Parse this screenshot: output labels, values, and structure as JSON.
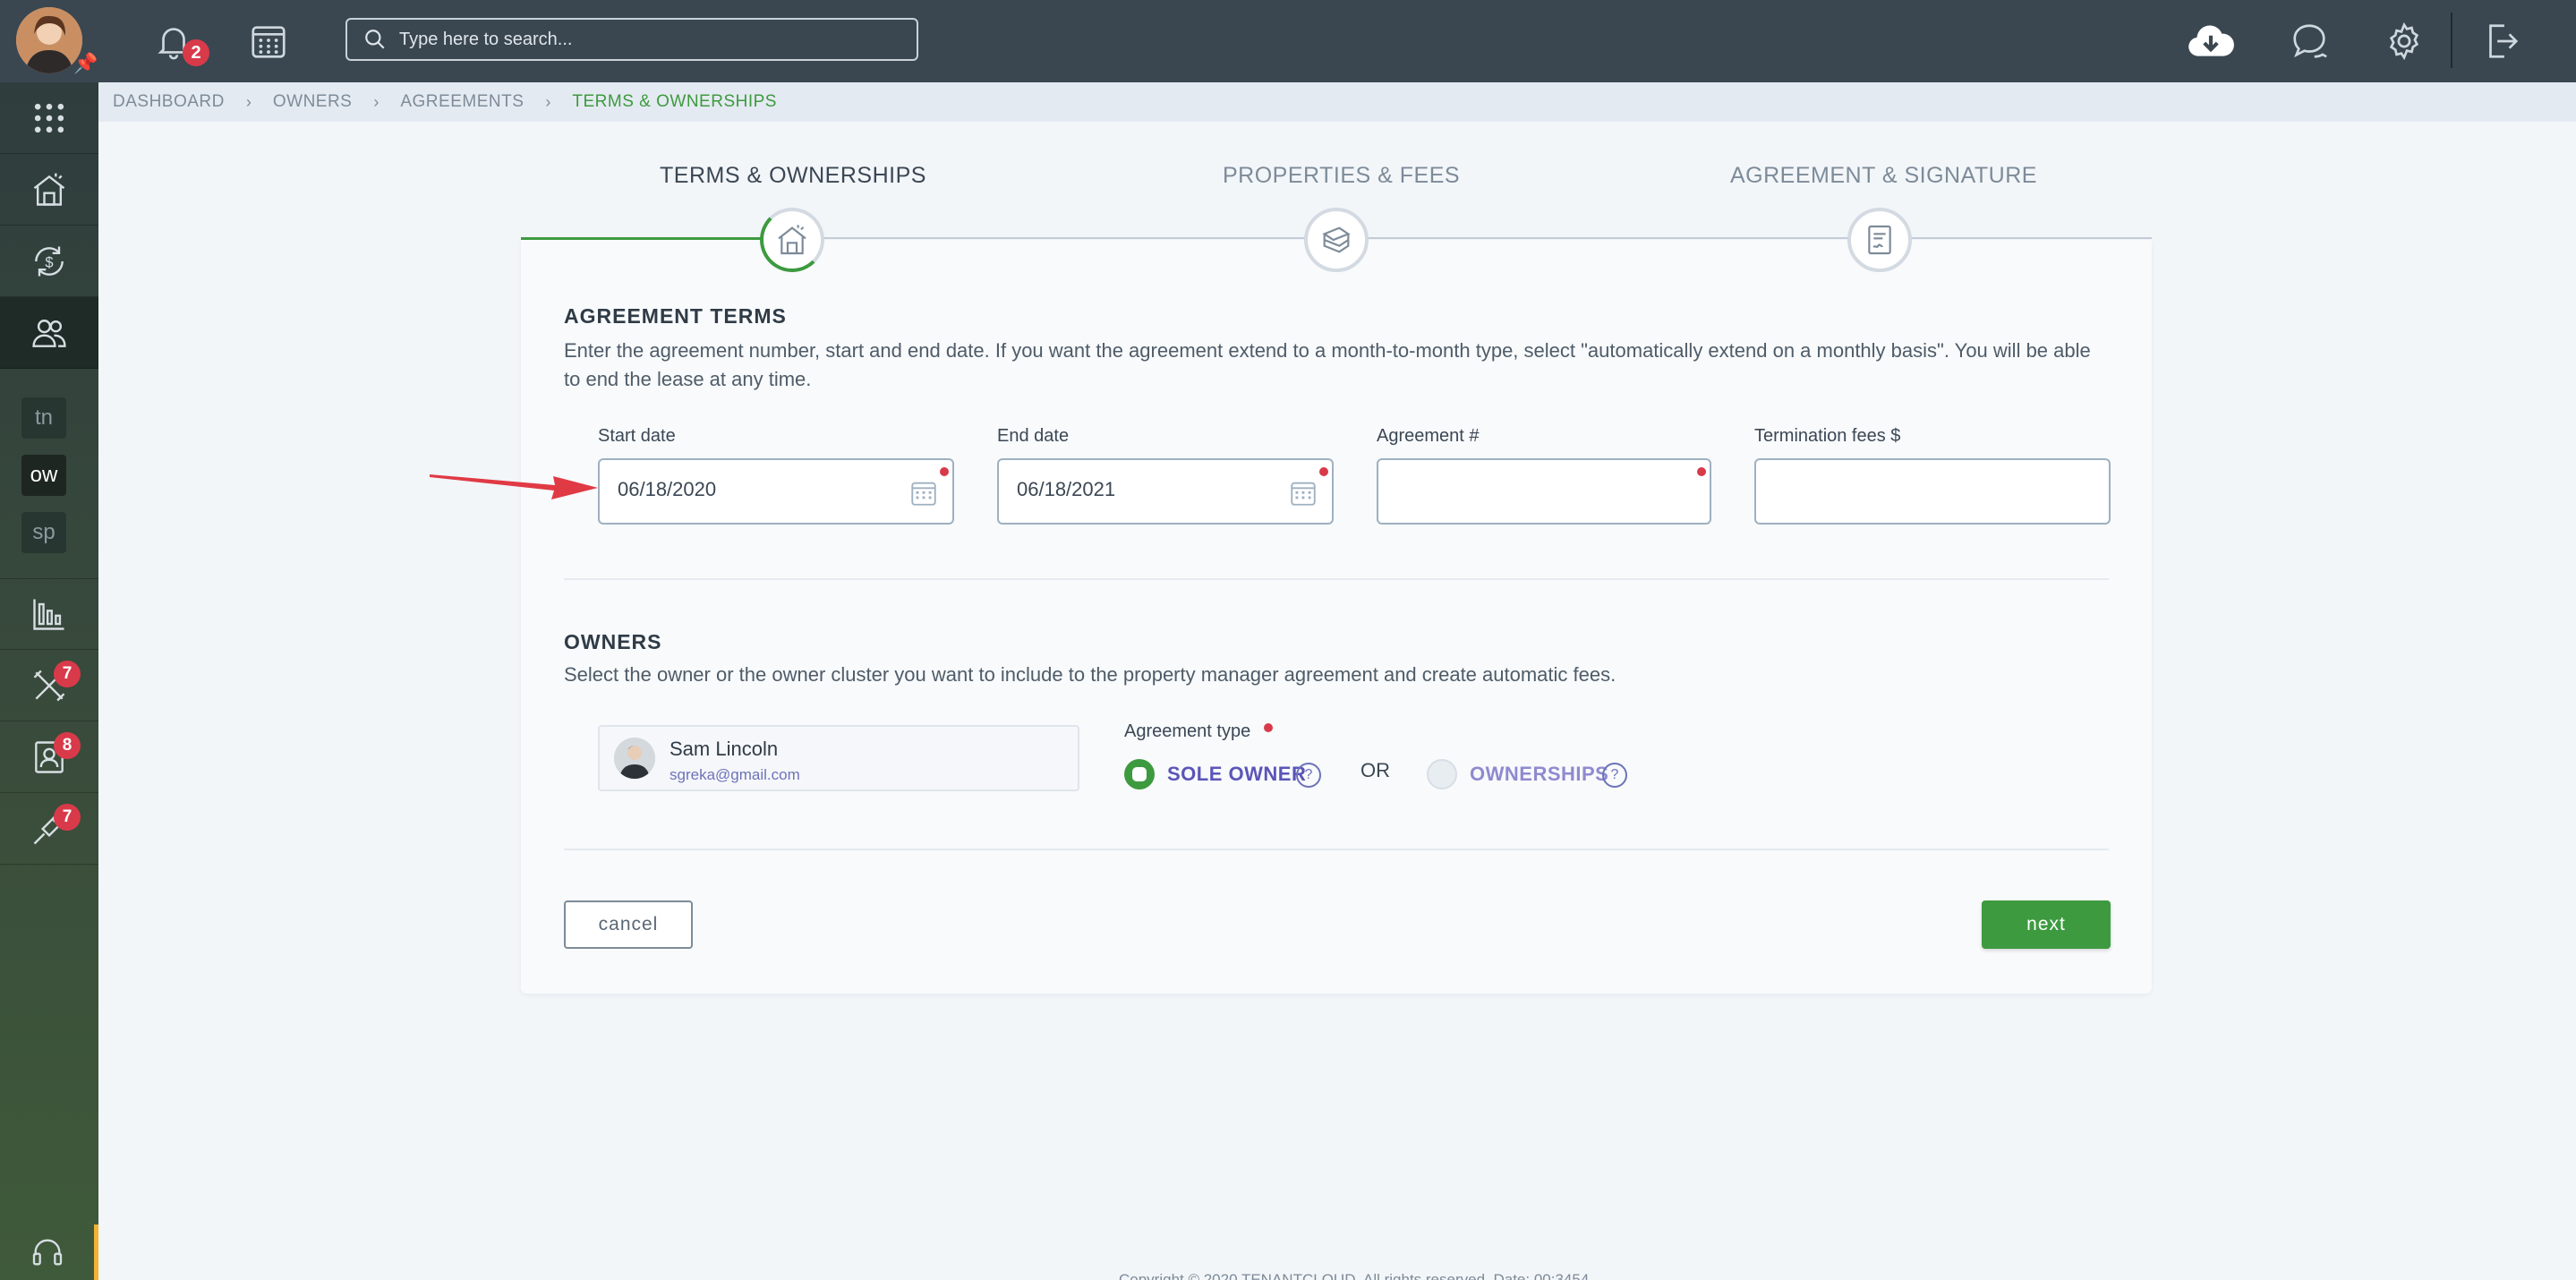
{
  "topbar": {
    "notifications_badge": "2",
    "search_placeholder": "Type here to search..."
  },
  "sidebar": {
    "chips": [
      "tn",
      "ow",
      "sp"
    ],
    "badges": {
      "maintenance": "7",
      "applications": "8",
      "tools": "7"
    }
  },
  "breadcrumb": [
    "DASHBOARD",
    "OWNERS",
    "AGREEMENTS",
    "TERMS & OWNERSHIPS"
  ],
  "steps": [
    {
      "label": "TERMS & OWNERSHIPS",
      "icon": "house-icon",
      "state": "active"
    },
    {
      "label": "PROPERTIES & FEES",
      "icon": "money-stack-icon",
      "state": "pending"
    },
    {
      "label": "AGREEMENT & SIGNATURE",
      "icon": "document-signature-icon",
      "state": "pending"
    }
  ],
  "agreement_terms": {
    "title": "AGREEMENT TERMS",
    "description_line1": "Enter the agreement number, start and end date. If you want the agreement extend to a month-to-month type, select \"automatically extend on a monthly basis\". You will be able",
    "description_line2": "to end the lease at any time.",
    "start_date": {
      "label": "Start date",
      "value": "06/18/2020"
    },
    "end_date": {
      "label": "End date",
      "value": "06/18/2021"
    },
    "agreement_number": {
      "label": "Agreement #",
      "value": ""
    },
    "termination_fees": {
      "label": "Termination fees $",
      "value": ""
    }
  },
  "owners": {
    "title": "OWNERS",
    "description": "Select the owner or the owner cluster you want to include to the property manager agreement and create automatic fees.",
    "owner": {
      "name": "Sam Lincoln",
      "email": "sgreka@gmail.com"
    },
    "agreement_type_label": "Agreement type",
    "option_sole": "SOLE OWNER",
    "option_or": "OR",
    "option_ownerships": "OWNERSHIPS",
    "help_glyph": "?",
    "selected": "sole_owner"
  },
  "buttons": {
    "cancel": "cancel",
    "next": "next"
  },
  "footer": {
    "text": "Copyright © 2020 TENANTCLOUD. All rights reserved. Date: 00:3454"
  },
  "colors": {
    "accent_green": "#3d9a3f",
    "badge_red": "#d83a4a",
    "topbar": "#3a4751",
    "annotation_arrow": "#e03a45"
  }
}
